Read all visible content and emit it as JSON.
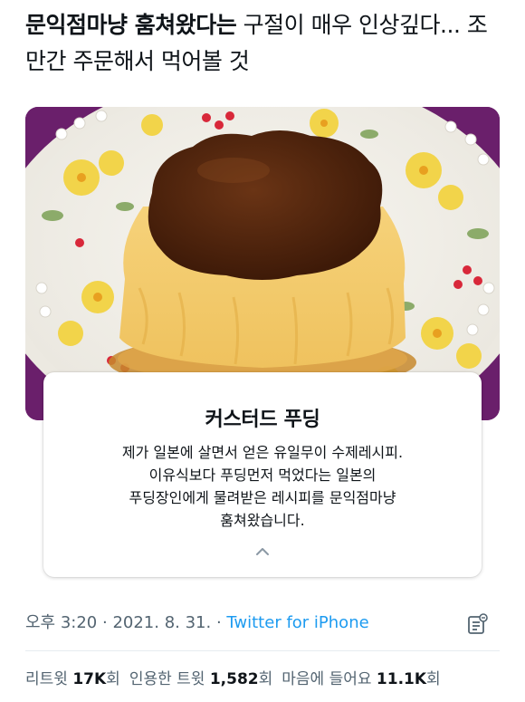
{
  "tweet": {
    "text_bold": "문익점마냥 훔쳐왔다는",
    "text_rest": " 구절이 매우 인상깊다... 조만간 주문해서 먹어볼 것"
  },
  "image_popup": {
    "title": "커스터드 푸딩",
    "lines": [
      "제가 일본에 살면서 얻은 유일무이 수제레시피.",
      "이유식보다 푸딩먼저 먹었다는 일본의",
      "푸딩장인에게 물려받은 레시피를 문익점마냥",
      "훔쳐왔습니다."
    ],
    "collapse_icon": "chevron-up-icon"
  },
  "meta": {
    "time": "오후 3:20",
    "sep1": " · ",
    "date": "2021. 8. 31.",
    "sep2": " · ",
    "source": "Twitter for iPhone",
    "analytics_icon": "analytics-icon"
  },
  "stats": {
    "retweets_label": "리트윗",
    "retweets_count": "17K",
    "retweets_unit": "회",
    "quotes_label": "인용한 트윗",
    "quotes_count": "1,582",
    "quotes_unit": "회",
    "likes_label": "마음에 들어요",
    "likes_count": "11.1K",
    "likes_unit": "회"
  },
  "colors": {
    "link": "#1d9bf0",
    "muted": "#536471",
    "divider": "#e6ecf0"
  }
}
